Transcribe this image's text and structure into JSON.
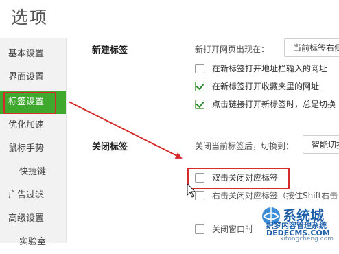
{
  "page_title": "选项",
  "sidebar": {
    "items": [
      {
        "label": "基本设置"
      },
      {
        "label": "界面设置"
      },
      {
        "label": "标签设置",
        "active": true
      },
      {
        "label": "优化加速"
      },
      {
        "label": "鼠标手势"
      },
      {
        "label": "快捷键"
      },
      {
        "label": "广告过滤"
      },
      {
        "label": "高级设置"
      },
      {
        "label": "实验室"
      }
    ]
  },
  "new_tab_section": {
    "title": "新建标签",
    "open_page_label": "新打开网页出现在：",
    "open_page_select": "当前标签右侧",
    "options": [
      {
        "label": "在新标签打开地址栏输入的网址",
        "checked": false
      },
      {
        "label": "在新标签打开收藏夹里的网址",
        "checked": true
      },
      {
        "label": "点击链接打开新标签时，总是切换",
        "checked": true
      }
    ]
  },
  "close_tab_section": {
    "title": "关闭标签",
    "switch_label": "关闭当前标签后，切换到：",
    "switch_select": "智能切换",
    "options": [
      {
        "label": "双击关闭对应标签",
        "checked": false
      },
      {
        "label": "右击关闭对应标签（按住Shift右击",
        "checked": false
      },
      {
        "label": "关闭窗口时",
        "checked": false
      }
    ]
  },
  "watermark": {
    "brand": "系统城",
    "site": "xitongcheng.com",
    "line1": "织梦内容管理系统",
    "line2": "DEDECMS.COM"
  },
  "colors": {
    "active_bg": "#3ea92d",
    "annotation_red": "#d52b2b"
  }
}
